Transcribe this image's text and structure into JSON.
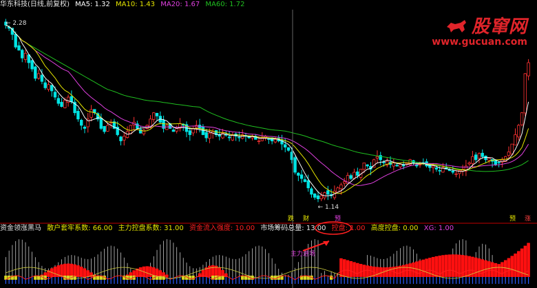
{
  "main_legend": {
    "title": "华东科技(日线,前复权)",
    "ma5": "MA5: 1.32",
    "ma10": "MA10: 1.43",
    "ma20": "MA20: 1.67",
    "ma60": "MA60: 1.72"
  },
  "indicator_legend": {
    "title": "资金领涨黑马",
    "items": [
      "散户套牢系数: 66.00",
      "主力控盘系数: 31.00",
      "资金流入强度: 10.00",
      "市场筹码总量: 13.00",
      "控盘: 1.00",
      "高度控盘: 0.00",
      "XG: 1.00"
    ]
  },
  "watermark": {
    "brand": "股窜网",
    "url": "www.gucuan.com"
  },
  "annotations": {
    "high_price": "2.28",
    "low_price": "1.14",
    "arrow_text": "主力进场",
    "markers": [
      "跌",
      "财",
      "预",
      "预",
      "涨"
    ]
  },
  "colors": {
    "background": "#000000",
    "up_candle": "#ff3232",
    "down_candle": "#00e4e4",
    "ma5": "#ffffff",
    "ma10": "#e6e600",
    "ma20": "#e040e0",
    "ma60": "#20c020",
    "bars_white": "#c8c8c8",
    "bars_red": "#ff1010",
    "bars_yellow": "#d8d820",
    "bars_blue": "#2a5cff",
    "highlight_ellipse": "#ff2020"
  },
  "chart_data": [
    {
      "type": "candlestick",
      "title": "华东科技(日线,前复权)",
      "ylim": [
        1.1,
        2.35
      ],
      "high": 2.28,
      "low": 1.14,
      "close_series": [
        2.26,
        2.24,
        2.2,
        2.12,
        2.1,
        2.05,
        2.08,
        2.02,
        1.98,
        1.92,
        1.95,
        1.9,
        1.86,
        1.88,
        1.84,
        1.8,
        1.76,
        1.74,
        1.78,
        1.8,
        1.77,
        1.7,
        1.66,
        1.62,
        1.6,
        1.66,
        1.72,
        1.7,
        1.66,
        1.6,
        1.58,
        1.62,
        1.64,
        1.6,
        1.56,
        1.52,
        1.55,
        1.58,
        1.62,
        1.64,
        1.6,
        1.57,
        1.59,
        1.62,
        1.66,
        1.7,
        1.68,
        1.64,
        1.6,
        1.62,
        1.6,
        1.58,
        1.6,
        1.63,
        1.62,
        1.58,
        1.56,
        1.6,
        1.62,
        1.6,
        1.56,
        1.54,
        1.57,
        1.58,
        1.56,
        1.55,
        1.57,
        1.56,
        1.54,
        1.56,
        1.55,
        1.54,
        1.56,
        1.55,
        1.54,
        1.55,
        1.53,
        1.52,
        1.54,
        1.55,
        1.53,
        1.52,
        1.53,
        1.52,
        1.5,
        1.48,
        1.46,
        1.4,
        1.32,
        1.3,
        1.28,
        1.26,
        1.22,
        1.18,
        1.16,
        1.15,
        1.17,
        1.19,
        1.18,
        1.17,
        1.2,
        1.22,
        1.24,
        1.26,
        1.3,
        1.28,
        1.32,
        1.3,
        1.34,
        1.38,
        1.36,
        1.34,
        1.4,
        1.42,
        1.4,
        1.38,
        1.39,
        1.37,
        1.38,
        1.36,
        1.37,
        1.36,
        1.38,
        1.4,
        1.38,
        1.36,
        1.37,
        1.38,
        1.36,
        1.35,
        1.36,
        1.34,
        1.33,
        1.35,
        1.34,
        1.33,
        1.32,
        1.31,
        1.33,
        1.34,
        1.36,
        1.38,
        1.42,
        1.4,
        1.44,
        1.42,
        1.4,
        1.41,
        1.39,
        1.37,
        1.38,
        1.4,
        1.42,
        1.45,
        1.5,
        1.56,
        1.62,
        1.7,
        1.95,
        2.02
      ]
    },
    {
      "type": "bar",
      "title": "资金领涨黑马",
      "series": [
        {
          "name": "散户套牢系数",
          "last": 66.0
        },
        {
          "name": "主力控盘系数",
          "last": 31.0
        },
        {
          "name": "资金流入强度",
          "last": 10.0
        },
        {
          "name": "市场筹码总量",
          "last": 13.0
        },
        {
          "name": "控盘",
          "last": 1.0
        },
        {
          "name": "高度控盘",
          "last": 0.0
        },
        {
          "name": "XG",
          "last": 1.0
        }
      ]
    }
  ]
}
